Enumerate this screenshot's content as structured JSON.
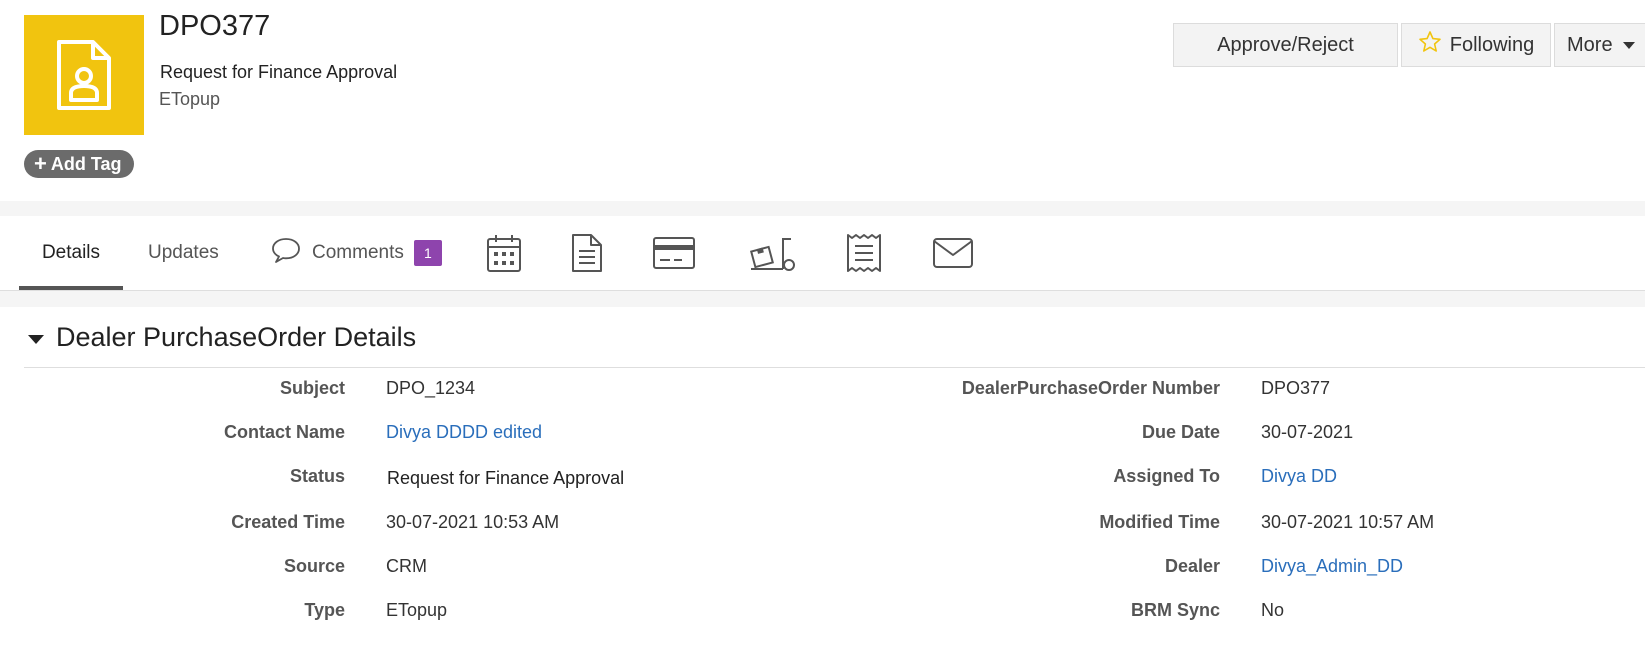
{
  "record": {
    "icon": "contact-document-icon",
    "accent": "#f1c40f",
    "title": "DPO377",
    "status": "Request for Finance Approval",
    "subtitle": "ETopup",
    "add_tag_label": "Add Tag"
  },
  "actions": {
    "approve_label": "Approve/Reject",
    "following_label": "Following",
    "more_label": "More"
  },
  "tabs": {
    "details": "Details",
    "updates": "Updates",
    "comments": "Comments",
    "comments_count": "1",
    "icons": [
      "calendar-icon",
      "document-icon",
      "credit-card-icon",
      "delivery-truck-icon",
      "receipt-icon",
      "mail-icon"
    ]
  },
  "section": {
    "title": "Dealer PurchaseOrder Details"
  },
  "fields": {
    "left": [
      {
        "label": "Subject",
        "value": "DPO_1234"
      },
      {
        "label": "Contact Name",
        "value": "Divya DDDD edited"
      },
      {
        "label": "Status",
        "value": "Request for Finance Approval"
      },
      {
        "label": "Created Time",
        "value": "30-07-2021 10:53 AM"
      },
      {
        "label": "Source",
        "value": "CRM"
      },
      {
        "label": "Type",
        "value": "ETopup"
      }
    ],
    "right": [
      {
        "label": "DealerPurchaseOrder Number",
        "value": "DPO377"
      },
      {
        "label": "Due Date",
        "value": "30-07-2021"
      },
      {
        "label": "Assigned To",
        "value": "Divya DD"
      },
      {
        "label": "Modified Time",
        "value": "30-07-2021 10:57 AM"
      },
      {
        "label": "Dealer",
        "value": "Divya_Admin_DD"
      },
      {
        "label": "BRM Sync",
        "value": "No"
      }
    ]
  },
  "colors": {
    "badge": "#8e44ad",
    "link": "#2a6ebb",
    "star": "#f1c40f"
  }
}
